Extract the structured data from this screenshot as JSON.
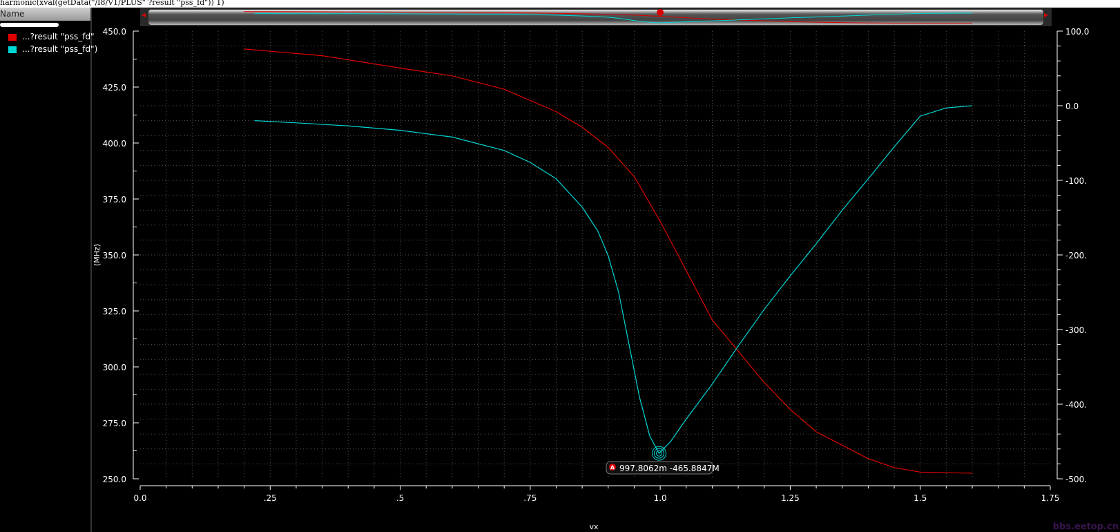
{
  "window_title": "harmonic(xval(getData(\"/I8/V1/PLUS\" ?result \"pss_fd\")) 1)",
  "panel": {
    "header": "Name",
    "traces": [
      {
        "label": "...?result \"pss_fd\"",
        "color": "#e00000"
      },
      {
        "label": "...?result \"pss_fd\")",
        "color": "#00d8d8"
      }
    ]
  },
  "marker": {
    "badge": "A",
    "label": "997.8062m -465.8847M"
  },
  "watermark": "bbs.eetop.cn",
  "chart_data": {
    "type": "line",
    "xlabel": "vx",
    "ylabel": "(MHz)",
    "xlim": [
      0,
      1.75
    ],
    "ylim_left": [
      250,
      450
    ],
    "ylim_right": [
      -500,
      100
    ],
    "x_ticks": [
      "0.0",
      ".25",
      ".5",
      ".75",
      "1.0",
      "1.25",
      "1.5",
      "1.75"
    ],
    "y_ticks_left": [
      "450.0",
      "425.0",
      "400.0",
      "375.0",
      "350.0",
      "325.0",
      "300.0",
      "275.0",
      "250.0"
    ],
    "y_ticks_right": [
      "100.0",
      "0.0",
      "-100.",
      "-200.",
      "-300.",
      "-400.",
      "-500."
    ],
    "grid": true,
    "series": [
      {
        "name": "...?result \"pss_fd\"",
        "axis": "left",
        "color": "#e00000",
        "x": [
          0.2,
          0.25,
          0.35,
          0.5,
          0.6,
          0.7,
          0.8,
          0.85,
          0.9,
          0.95,
          1.0,
          1.05,
          1.1,
          1.2,
          1.25,
          1.3,
          1.4,
          1.45,
          1.5,
          1.6
        ],
        "y": [
          442,
          441,
          439,
          433.5,
          430,
          424,
          414,
          407,
          398,
          385,
          365,
          343,
          321,
          293,
          281,
          271,
          259,
          255,
          253,
          252.5
        ]
      },
      {
        "name": "...?result \"pss_fd\")",
        "axis": "right",
        "color": "#00d8d8",
        "x": [
          0.22,
          0.3,
          0.4,
          0.5,
          0.6,
          0.7,
          0.75,
          0.8,
          0.85,
          0.88,
          0.9,
          0.92,
          0.94,
          0.96,
          0.98,
          0.9978,
          1.02,
          1.05,
          1.1,
          1.15,
          1.2,
          1.25,
          1.3,
          1.35,
          1.4,
          1.45,
          1.5,
          1.55,
          1.6
        ],
        "y": [
          -20,
          -23,
          -27,
          -33,
          -42,
          -60,
          -76,
          -98,
          -136,
          -168,
          -201,
          -250,
          -320,
          -390,
          -443,
          -465.88,
          -450,
          -420,
          -373,
          -322,
          -273,
          -228,
          -185,
          -140,
          -98,
          -55,
          -14,
          -3,
          0
        ]
      }
    ]
  }
}
